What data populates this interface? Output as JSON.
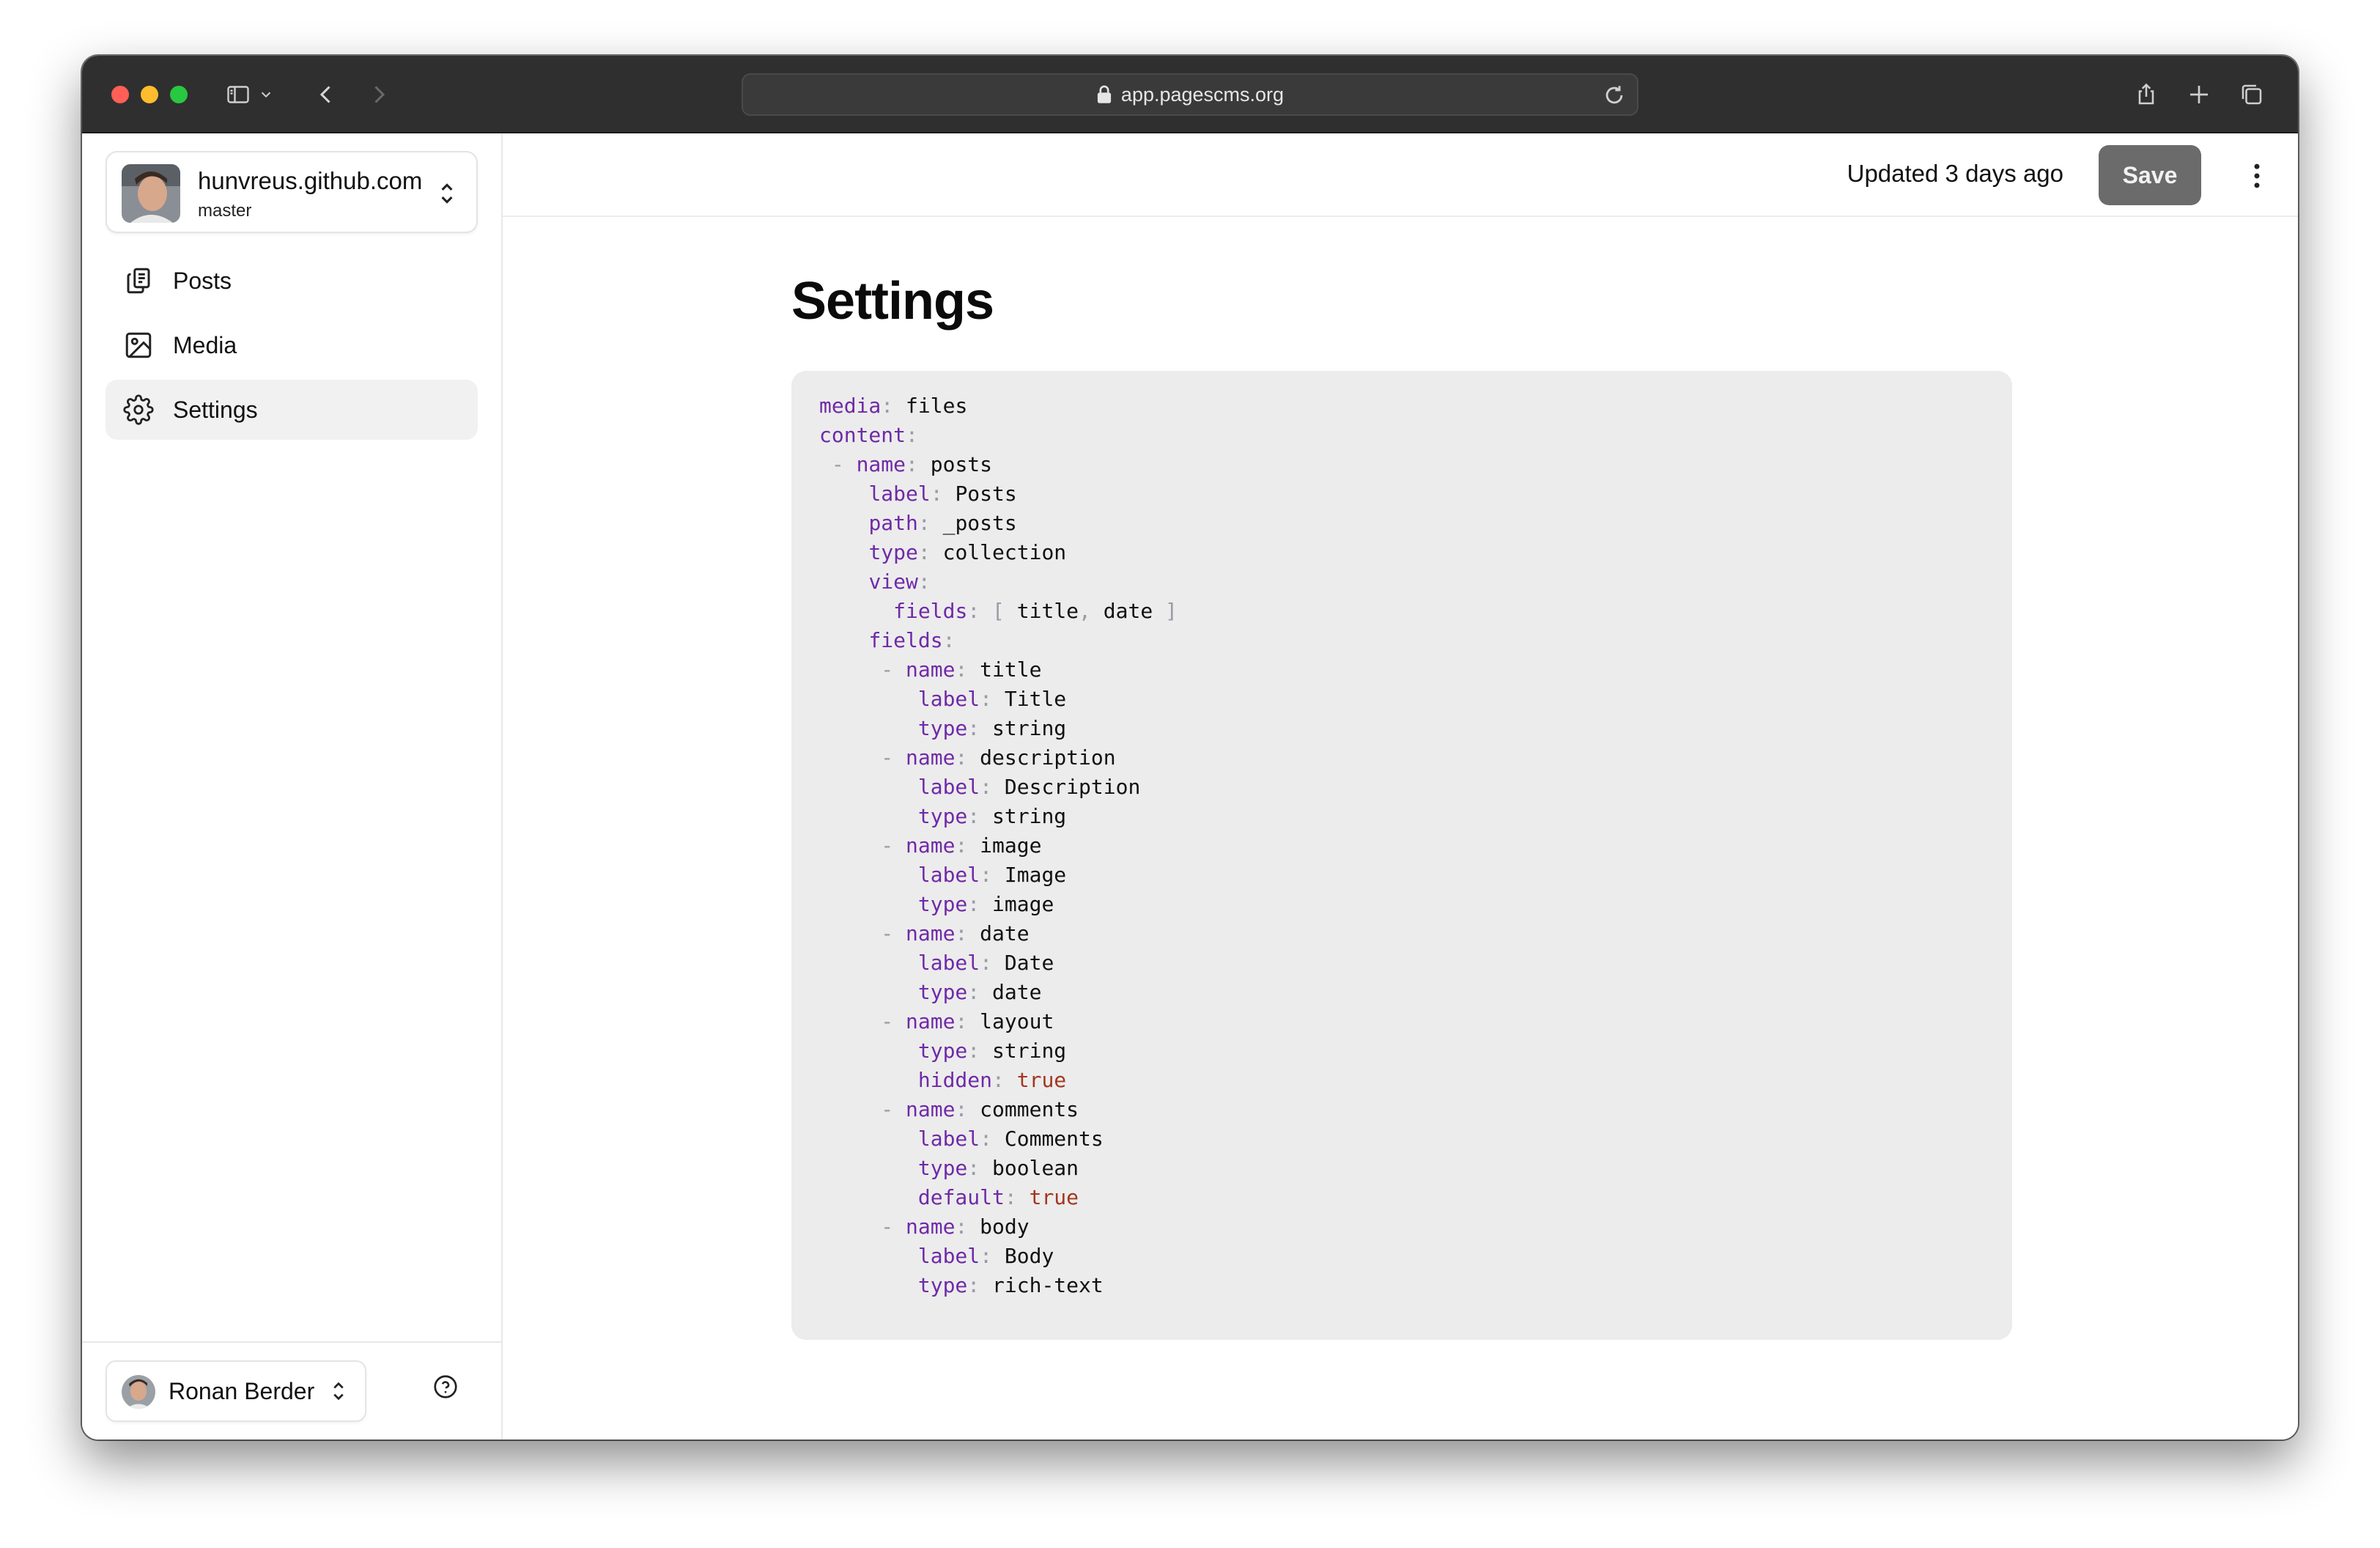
{
  "browser": {
    "url": "app.pagescms.org"
  },
  "sidebar": {
    "repo": {
      "name": "hunvreus.github.com",
      "branch": "master"
    },
    "items": [
      {
        "label": "Posts",
        "icon": "documents-icon",
        "active": false
      },
      {
        "label": "Media",
        "icon": "image-icon",
        "active": false
      },
      {
        "label": "Settings",
        "icon": "gear-icon",
        "active": true
      }
    ],
    "user": {
      "name": "Ronan Berder"
    }
  },
  "header": {
    "status": "Updated 3 days ago",
    "save_label": "Save"
  },
  "page": {
    "title": "Settings"
  },
  "editor": {
    "lines": [
      {
        "dash": false,
        "key": "media",
        "value": "files"
      },
      {
        "dash": false,
        "key": "content",
        "value": ""
      },
      {
        "dash": true,
        "key": "name",
        "value": "posts"
      },
      {
        "dash": false,
        "key": "label",
        "value": "Posts"
      },
      {
        "dash": false,
        "key": "path",
        "value": "_posts"
      },
      {
        "dash": false,
        "key": "type",
        "value": "collection"
      },
      {
        "dash": false,
        "key": "view",
        "value": ""
      },
      {
        "dash": false,
        "key": "fields",
        "value": "",
        "list": [
          "title",
          "date"
        ]
      },
      {
        "dash": false,
        "key": "fields",
        "value": ""
      },
      {
        "dash": true,
        "key": "name",
        "value": "title"
      },
      {
        "dash": false,
        "key": "label",
        "value": "Title"
      },
      {
        "dash": false,
        "key": "type",
        "value": "string"
      },
      {
        "dash": true,
        "key": "name",
        "value": "description"
      },
      {
        "dash": false,
        "key": "label",
        "value": "Description"
      },
      {
        "dash": false,
        "key": "type",
        "value": "string"
      },
      {
        "dash": true,
        "key": "name",
        "value": "image"
      },
      {
        "dash": false,
        "key": "label",
        "value": "Image"
      },
      {
        "dash": false,
        "key": "type",
        "value": "image"
      },
      {
        "dash": true,
        "key": "name",
        "value": "date"
      },
      {
        "dash": false,
        "key": "label",
        "value": "Date"
      },
      {
        "dash": false,
        "key": "type",
        "value": "date"
      },
      {
        "dash": true,
        "key": "name",
        "value": "layout"
      },
      {
        "dash": false,
        "key": "type",
        "value": "string"
      },
      {
        "dash": false,
        "key": "hidden",
        "value": "true",
        "bool": true
      },
      {
        "dash": true,
        "key": "name",
        "value": "comments"
      },
      {
        "dash": false,
        "key": "label",
        "value": "Comments"
      },
      {
        "dash": false,
        "key": "type",
        "value": "boolean"
      },
      {
        "dash": false,
        "key": "default",
        "value": "true",
        "bool": true
      },
      {
        "dash": true,
        "key": "name",
        "value": "body"
      },
      {
        "dash": false,
        "key": "label",
        "value": "Body"
      },
      {
        "dash": false,
        "key": "type",
        "value": "rich-text"
      }
    ]
  },
  "colors": {
    "yaml_key": "#6f2aa8",
    "yaml_bool": "#a3361f",
    "save_button_bg": "#6b6b6b",
    "active_nav_bg": "#f1f1f1"
  }
}
